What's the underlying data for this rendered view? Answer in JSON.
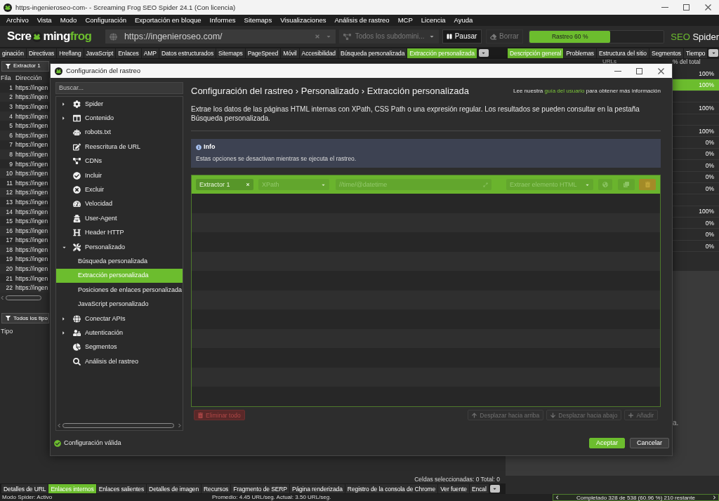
{
  "window": {
    "title": "https-ingenieroseo-com- - Screaming Frog SEO Spider 24.1 (Con licencia)"
  },
  "menu": [
    "Archivo",
    "Vista",
    "Modo",
    "Configuración",
    "Exportación en bloque",
    "Informes",
    "Sitemaps",
    "Visualizaciones",
    "Análisis de rastreo",
    "MCP",
    "Licencia",
    "Ayuda"
  ],
  "toolbar": {
    "logo": {
      "start": "Scre",
      "middle": "ming",
      "accent": "frog"
    },
    "url_field": {
      "value": "https://ingenieroseo.com/"
    },
    "subdomain_dropdown": {
      "value": "Todos los subdomini...",
      "disabled": true
    },
    "pause_button": {
      "label": "Pausar",
      "disabled": false
    },
    "clear_button": {
      "label": "Borrar",
      "disabled": true
    },
    "progress": {
      "label": "Rastreo 60 %",
      "level": 0.6
    },
    "product_name": {
      "accent": "SEO",
      "rest": "Spider"
    }
  },
  "main_tabs": [
    {
      "label": "ginación",
      "selected": false
    },
    {
      "label": "Directivas",
      "selected": false
    },
    {
      "label": "Hreflang",
      "selected": false
    },
    {
      "label": "JavaScript",
      "selected": false
    },
    {
      "label": "Enlaces",
      "selected": false
    },
    {
      "label": "AMP",
      "selected": false
    },
    {
      "label": "Datos estructurados",
      "selected": false
    },
    {
      "label": "Sitemaps",
      "selected": false
    },
    {
      "label": "PageSpeed",
      "selected": false
    },
    {
      "label": "Móvil",
      "selected": false
    },
    {
      "label": "Accesibilidad",
      "selected": false
    },
    {
      "label": "Búsqueda personalizada",
      "selected": false
    },
    {
      "label": "Extracción personalizada",
      "selected": true
    }
  ],
  "overview_tabs": [
    {
      "label": "Descripción general",
      "selected": true
    },
    {
      "label": "Problemas",
      "selected": false
    },
    {
      "label": "Estructura del sitio",
      "selected": false
    },
    {
      "label": "Segmentos",
      "selected": false
    },
    {
      "label": "Tiempo",
      "selected": false
    }
  ],
  "results_pane": {
    "filter": "Extractor 1",
    "columns": [
      "Fila",
      "Dirección"
    ],
    "rows": [
      {
        "number": "1",
        "address": "https://ingen"
      },
      {
        "number": "2",
        "address": "https://ingen"
      },
      {
        "number": "3",
        "address": "https://ingen"
      },
      {
        "number": "4",
        "address": "https://ingen"
      },
      {
        "number": "5",
        "address": "https://ingen"
      },
      {
        "number": "6",
        "address": "https://ingen"
      },
      {
        "number": "7",
        "address": "https://ingen"
      },
      {
        "number": "8",
        "address": "https://ingen"
      },
      {
        "number": "9",
        "address": "https://ingen"
      },
      {
        "number": "10",
        "address": "https://ingen"
      },
      {
        "number": "11",
        "address": "https://ingen"
      },
      {
        "number": "12",
        "address": "https://ingen"
      },
      {
        "number": "13",
        "address": "https://ingen"
      },
      {
        "number": "14",
        "address": "https://ingen"
      },
      {
        "number": "15",
        "address": "https://ingen"
      },
      {
        "number": "16",
        "address": "https://ingen"
      },
      {
        "number": "17",
        "address": "https://ingen"
      },
      {
        "number": "18",
        "address": "https://ingen"
      },
      {
        "number": "19",
        "address": "https://ingen"
      },
      {
        "number": "20",
        "address": "https://ingen"
      },
      {
        "number": "21",
        "address": "https://ingen"
      },
      {
        "number": "22",
        "address": "https://ingen"
      }
    ]
  },
  "lower_pane": {
    "filter": "Todos los tipo",
    "columns": [
      "Tipo"
    ]
  },
  "overview_pane": {
    "columns": [
      "URLs",
      "% del total"
    ],
    "rows": [
      {
        "percent": "100%",
        "selected": false
      },
      {
        "percent": "100%",
        "selected": true
      },
      {
        "selected": false
      },
      {
        "percent": "100%",
        "selected": false
      },
      {
        "selected": false
      },
      {
        "percent": "100%",
        "selected": false
      },
      {
        "percent": "0%",
        "selected": false
      },
      {
        "percent": "0%",
        "selected": false
      },
      {
        "percent": "0%",
        "selected": false
      },
      {
        "percent": "0%",
        "selected": false
      },
      {
        "percent": "0%",
        "selected": false
      },
      {
        "selected": false
      },
      {
        "percent": "100%",
        "selected": false
      },
      {
        "percent": "0%",
        "selected": false
      },
      {
        "percent": "0%",
        "selected": false
      },
      {
        "percent": "0%",
        "selected": false
      }
    ]
  },
  "chart_panel": {
    "text": "a."
  },
  "dialog": {
    "title": "Configuración del rastreo",
    "search": {
      "placeholder": "Buscar..."
    },
    "tree": [
      {
        "label": "Spider",
        "kind": "group",
        "expanded": false,
        "selected": false
      },
      {
        "label": "Contenido",
        "kind": "group",
        "expanded": false,
        "selected": false
      },
      {
        "label": "robots.txt",
        "kind": "page",
        "selected": false
      },
      {
        "label": "Reescritura de URL",
        "kind": "page",
        "selected": false
      },
      {
        "label": "CDNs",
        "kind": "page",
        "selected": false
      },
      {
        "label": "Incluir",
        "kind": "page",
        "selected": false
      },
      {
        "label": "Excluir",
        "kind": "page",
        "selected": false
      },
      {
        "label": "Velocidad",
        "kind": "page",
        "selected": false
      },
      {
        "label": "User-Agent",
        "kind": "page",
        "selected": false
      },
      {
        "label": "Header HTTP",
        "kind": "page",
        "selected": false
      },
      {
        "label": "Personalizado",
        "kind": "group",
        "expanded": true,
        "selected": false,
        "children": [
          {
            "label": "Búsqueda personalizada",
            "selected": false
          },
          {
            "label": "Extracción personalizada",
            "selected": true
          },
          {
            "label": "Posiciones de enlaces personalizada",
            "selected": false
          },
          {
            "label": "JavaScript personalizado",
            "selected": false
          }
        ]
      },
      {
        "label": "Conectar APIs",
        "kind": "group",
        "expanded": false,
        "selected": false
      },
      {
        "label": "Autenticación",
        "kind": "group",
        "expanded": false,
        "selected": false
      },
      {
        "label": "Segmentos",
        "kind": "page",
        "selected": false
      },
      {
        "label": "Análisis del rastreo",
        "kind": "page",
        "selected": false
      }
    ],
    "heading": "Configuración del rastreo › Personalizado › Extracción personalizada",
    "help": {
      "before": "Lee nuestra",
      "link": "guía del usuario",
      "after": "para obtener más información"
    },
    "description": "Extrae los datos de las páginas HTML internas con XPath, CSS Path o una expresión regular. Los resultados se pueden consultar en la pestaña Búsqueda personalizada.",
    "info": {
      "title": "Info",
      "message": "Estas opciones se desactivan mientras se ejecuta el rastreo."
    },
    "extractors": [
      {
        "name": "Extractor 1",
        "type": "XPath",
        "expression": "//time/@datetime",
        "extract": "Extraer elemento HTML",
        "selected": true,
        "disabled": true
      }
    ],
    "table_buttons": [
      {
        "label": "Eliminar todo",
        "kind": "delete",
        "disabled": true
      },
      {
        "label": "Desplazar hacia arriba",
        "kind": "up",
        "disabled": true
      },
      {
        "label": "Desplazar hacia abajo",
        "kind": "down",
        "disabled": true
      },
      {
        "label": "Añadir",
        "kind": "add",
        "disabled": true
      }
    ],
    "status": {
      "label": "Configuración válida",
      "valid": true
    },
    "buttons": [
      {
        "label": "Aceptar",
        "kind": "primary"
      },
      {
        "label": "Cancelar",
        "kind": "secondary"
      }
    ]
  },
  "selection_info": "Celdas seleccionadas: 0 Total: 0",
  "bottom_tabs": [
    {
      "label": "Detalles de URL",
      "selected": false
    },
    {
      "label": "Enlaces internos",
      "selected": true
    },
    {
      "label": "Enlaces salientes",
      "selected": false
    },
    {
      "label": "Detalles de imagen",
      "selected": false
    },
    {
      "label": "Recursos",
      "selected": false
    },
    {
      "label": "Fragmento de SERP",
      "selected": false
    },
    {
      "label": "Página renderizada",
      "selected": false
    },
    {
      "label": "Registro de la consola de Chrome",
      "selected": false
    },
    {
      "label": "Ver fuente",
      "selected": false
    },
    {
      "label": "Encal",
      "selected": false
    }
  ],
  "status_bar": {
    "mode": "Modo Spider: Activo",
    "speed": "Promedio: 4.45 URL/seg. Actual: 3.50 URL/seg.",
    "progress": "Completado 328 de 538 (60.96 %) 210 restante"
  }
}
